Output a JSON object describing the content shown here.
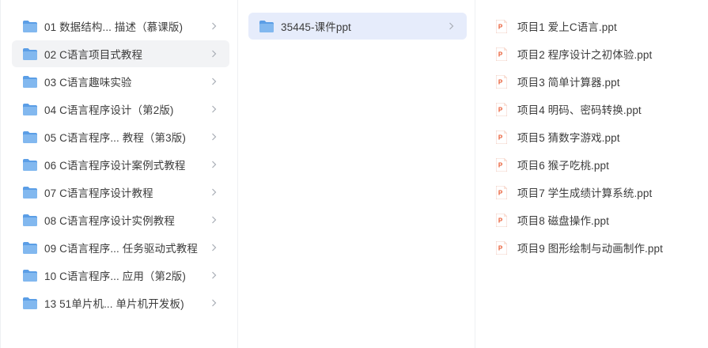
{
  "columns": {
    "first": {
      "items": [
        {
          "label": "01 数据结构...   描述（慕课版)"
        },
        {
          "label": "02  C语言项目式教程"
        },
        {
          "label": "03  C语言趣味实验"
        },
        {
          "label": "04  C语言程序设计（第2版)"
        },
        {
          "label": "05 C语言程序...  教程（第3版)"
        },
        {
          "label": "06 C语言程序设计案例式教程"
        },
        {
          "label": "07 C语言程序设计教程"
        },
        {
          "label": "08  C语言程序设计实例教程"
        },
        {
          "label": "09 C语言程序... 任务驱动式教程"
        },
        {
          "label": "10  C语言程序... 应用（第2版)"
        },
        {
          "label": "13  51单片机... 单片机开发板)"
        }
      ],
      "hovered_index": 1
    },
    "second": {
      "items": [
        {
          "label": "35445-课件ppt"
        }
      ],
      "selected_index": 0
    },
    "third": {
      "items": [
        {
          "label": "项目1 爱上C语言.ppt"
        },
        {
          "label": "项目2 程序设计之初体验.ppt"
        },
        {
          "label": "项目3 简单计算器.ppt"
        },
        {
          "label": "项目4 明码、密码转换.ppt"
        },
        {
          "label": "项目5 猜数字游戏.ppt"
        },
        {
          "label": "项目6 猴子吃桃.ppt"
        },
        {
          "label": "项目7 学生成绩计算系统.ppt"
        },
        {
          "label": "项目8 磁盘操作.ppt"
        },
        {
          "label": "项目9 图形绘制与动画制作.ppt"
        }
      ]
    }
  },
  "icons": {
    "folder": "folder-icon",
    "ppt_file": "ppt-file-icon",
    "chevron": "chevron-right-icon"
  },
  "colors": {
    "folder_fill": "#5b9ee6",
    "folder_fill_top": "#82b8ef",
    "ppt_orange": "#e8572e",
    "hover_bg": "#f2f3f5",
    "selected_bg": "#e6ecfb",
    "text": "#3c3c3c",
    "chevron": "#a8adb5"
  }
}
